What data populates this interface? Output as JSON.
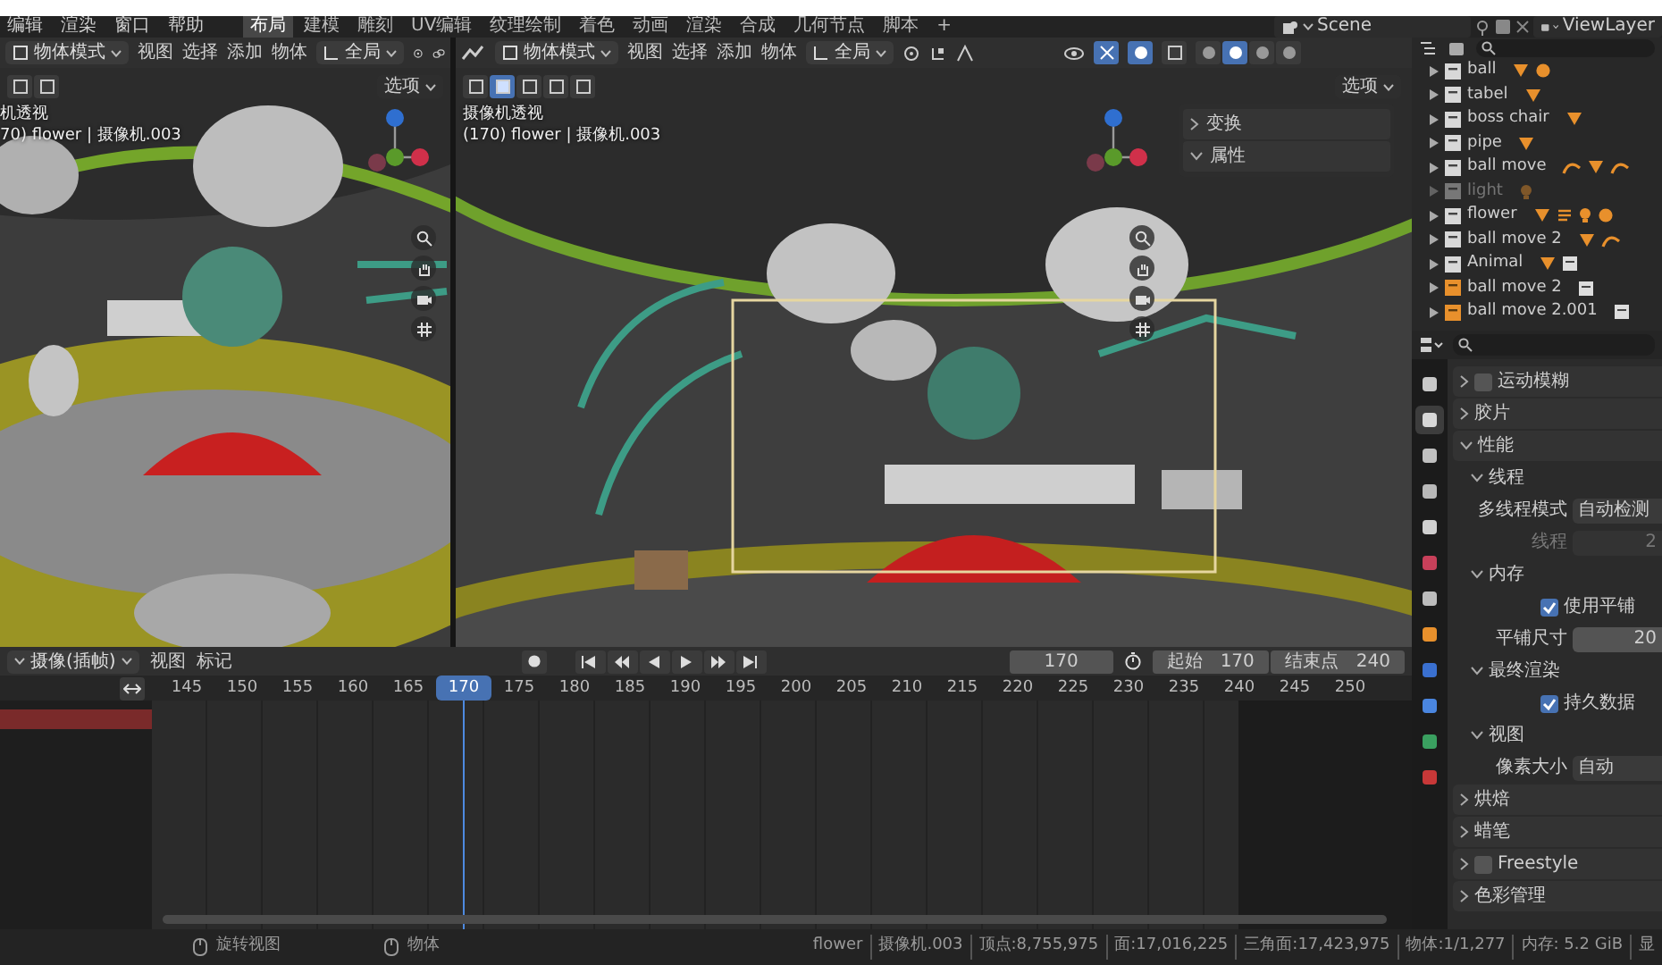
{
  "menu": [
    "编辑",
    "渲染",
    "窗口",
    "帮助"
  ],
  "workspaces": [
    {
      "label": "布局",
      "selected": true
    },
    {
      "label": "建模",
      "selected": false
    },
    {
      "label": "雕刻",
      "selected": false
    },
    {
      "label": "UV编辑",
      "selected": false
    },
    {
      "label": "纹理绘制",
      "selected": false
    },
    {
      "label": "着色",
      "selected": false
    },
    {
      "label": "动画",
      "selected": false
    },
    {
      "label": "渲染",
      "selected": false
    },
    {
      "label": "合成",
      "selected": false
    },
    {
      "label": "几何节点",
      "selected": false
    },
    {
      "label": "脚本",
      "selected": false
    }
  ],
  "add_workspace": "+",
  "scene": "Scene",
  "view_layer": "ViewLayer",
  "viewports": [
    {
      "mode": "物体模式",
      "menus": [
        "视图",
        "选择",
        "添加",
        "物体"
      ],
      "orientation": "全局",
      "options": "选项",
      "camera_label": "机透视",
      "object_info": "70) flower | 摄像机.003",
      "select_modes": [
        {
          "selected": false
        },
        {
          "selected": false
        }
      ]
    },
    {
      "mode": "物体模式",
      "menus": [
        "视图",
        "选择",
        "添加",
        "物体"
      ],
      "orientation": "全局",
      "options": "选项",
      "camera_label": "摄像机透视",
      "object_info": "(170) flower | 摄像机.003",
      "select_modes": [
        {
          "selected": false
        },
        {
          "selected": true
        },
        {
          "selected": false
        },
        {
          "selected": false
        },
        {
          "selected": false
        }
      ],
      "shading": [
        {
          "selected": false
        },
        {
          "selected": true
        },
        {
          "selected": false
        },
        {
          "selected": false
        }
      ],
      "side_panel": [
        {
          "label": "变换",
          "expanded": false
        },
        {
          "label": "属性",
          "expanded": true
        }
      ]
    }
  ],
  "outliner": [
    {
      "name": "ball",
      "kind": "collection",
      "disabled": false,
      "badges": [
        {
          "kind": "mesh"
        },
        {
          "kind": "material"
        }
      ]
    },
    {
      "name": "tabel",
      "kind": "collection",
      "disabled": false,
      "badges": [
        {
          "kind": "mesh"
        }
      ]
    },
    {
      "name": "boss chair",
      "kind": "collection",
      "disabled": false,
      "badges": [
        {
          "kind": "mesh"
        }
      ]
    },
    {
      "name": "pipe",
      "kind": "collection",
      "disabled": false,
      "badges": [
        {
          "kind": "mesh"
        }
      ]
    },
    {
      "name": "ball move",
      "kind": "collection",
      "disabled": false,
      "badges": [
        {
          "kind": "curve"
        },
        {
          "kind": "mesh"
        },
        {
          "kind": "curve"
        }
      ]
    },
    {
      "name": "light",
      "kind": "collection",
      "disabled": true,
      "badges": [
        {
          "kind": "light"
        }
      ]
    },
    {
      "name": "flower",
      "kind": "collection",
      "disabled": false,
      "badges": [
        {
          "kind": "mesh"
        },
        {
          "kind": "text"
        },
        {
          "kind": "light"
        },
        {
          "kind": "material"
        }
      ]
    },
    {
      "name": "ball move 2",
      "kind": "collection",
      "disabled": false,
      "badges": [
        {
          "kind": "mesh"
        },
        {
          "kind": "curve"
        }
      ]
    },
    {
      "name": "Animal",
      "kind": "collection",
      "disabled": false,
      "badges": [
        {
          "kind": "mesh"
        },
        {
          "kind": "collection"
        }
      ]
    },
    {
      "name": "ball move 2",
      "kind": "instance",
      "disabled": false,
      "badges": [
        {
          "kind": "collection"
        }
      ]
    },
    {
      "name": "ball move 2.001",
      "kind": "instance",
      "disabled": false,
      "badges": [
        {
          "kind": "collection"
        }
      ]
    }
  ],
  "properties": {
    "tabs": [
      {
        "selected": false,
        "color": "#c8c8c8"
      },
      {
        "selected": true,
        "color": "#d8d8d8"
      },
      {
        "selected": false,
        "color": "#c0c0c0"
      },
      {
        "selected": false,
        "color": "#b8b8b8"
      },
      {
        "selected": false,
        "color": "#d0d0d0"
      },
      {
        "selected": false,
        "color": "#c8405a"
      },
      {
        "selected": false,
        "color": "#bcbcbc"
      },
      {
        "selected": false,
        "color": "#e8902c"
      },
      {
        "selected": false,
        "color": "#3a70d0"
      },
      {
        "selected": false,
        "color": "#4a86e0"
      },
      {
        "selected": false,
        "color": "#3aa060"
      },
      {
        "selected": false,
        "color": "#c83838"
      }
    ],
    "rows": [
      {
        "kind": "section",
        "label": "运动模糊",
        "expanded": false,
        "checked": false
      },
      {
        "kind": "section",
        "label": "胶片",
        "expanded": false
      },
      {
        "kind": "section",
        "label": "性能",
        "expanded": true,
        "children": [
          {
            "kind": "section",
            "label": "线程",
            "expanded": true,
            "children": [
              {
                "kind": "select",
                "label": "多线程模式",
                "value": "自动检测",
                "disabled": false
              },
              {
                "kind": "number",
                "label": "线程",
                "value": "2",
                "disabled": true
              }
            ]
          },
          {
            "kind": "section",
            "label": "内存",
            "expanded": true,
            "children": [
              {
                "kind": "checkbox",
                "label": "使用平铺",
                "checked": true
              },
              {
                "kind": "number",
                "label": "平铺尺寸",
                "value": "20",
                "disabled": false
              }
            ]
          },
          {
            "kind": "section",
            "label": "最终渲染",
            "expanded": true,
            "children": [
              {
                "kind": "checkbox",
                "label": "持久数据",
                "checked": true
              }
            ]
          },
          {
            "kind": "section",
            "label": "视图",
            "expanded": true,
            "children": [
              {
                "kind": "select",
                "label": "像素大小",
                "value": "自动",
                "disabled": false
              }
            ]
          }
        ]
      },
      {
        "kind": "section",
        "label": "烘焙",
        "expanded": false
      },
      {
        "kind": "section",
        "label": "蜡笔",
        "expanded": false
      },
      {
        "kind": "section",
        "label": "Freestyle",
        "expanded": false,
        "checked": false
      },
      {
        "kind": "section",
        "label": "色彩管理",
        "expanded": false
      }
    ]
  },
  "timeline": {
    "mode": "摄像(插帧)",
    "menus": [
      "视图",
      "标记"
    ],
    "current_frame": "170",
    "start_label": "起始",
    "start": "170",
    "end_label": "结束点",
    "end": "240",
    "ticks": [
      {
        "label": "145",
        "selected": false
      },
      {
        "label": "150",
        "selected": false
      },
      {
        "label": "155",
        "selected": false
      },
      {
        "label": "160",
        "selected": false
      },
      {
        "label": "165",
        "selected": false
      },
      {
        "label": "170",
        "selected": true
      },
      {
        "label": "175",
        "selected": false
      },
      {
        "label": "180",
        "selected": false
      },
      {
        "label": "185",
        "selected": false
      },
      {
        "label": "190",
        "selected": false
      },
      {
        "label": "195",
        "selected": false
      },
      {
        "label": "200",
        "selected": false
      },
      {
        "label": "205",
        "selected": false
      },
      {
        "label": "210",
        "selected": false
      },
      {
        "label": "215",
        "selected": false
      },
      {
        "label": "220",
        "selected": false
      },
      {
        "label": "225",
        "selected": false
      },
      {
        "label": "230",
        "selected": false
      },
      {
        "label": "235",
        "selected": false
      },
      {
        "label": "240",
        "selected": false
      },
      {
        "label": "245",
        "selected": false
      },
      {
        "label": "250",
        "selected": false
      }
    ]
  },
  "status": {
    "hints": [
      "旋转视图",
      "物体"
    ],
    "stats": [
      "flower",
      "摄像机.003",
      "顶点:8,755,975",
      "面:17,016,225",
      "三角面:17,423,975",
      "物体:1/1,277",
      "内存: 5.2 GiB",
      "显"
    ]
  }
}
